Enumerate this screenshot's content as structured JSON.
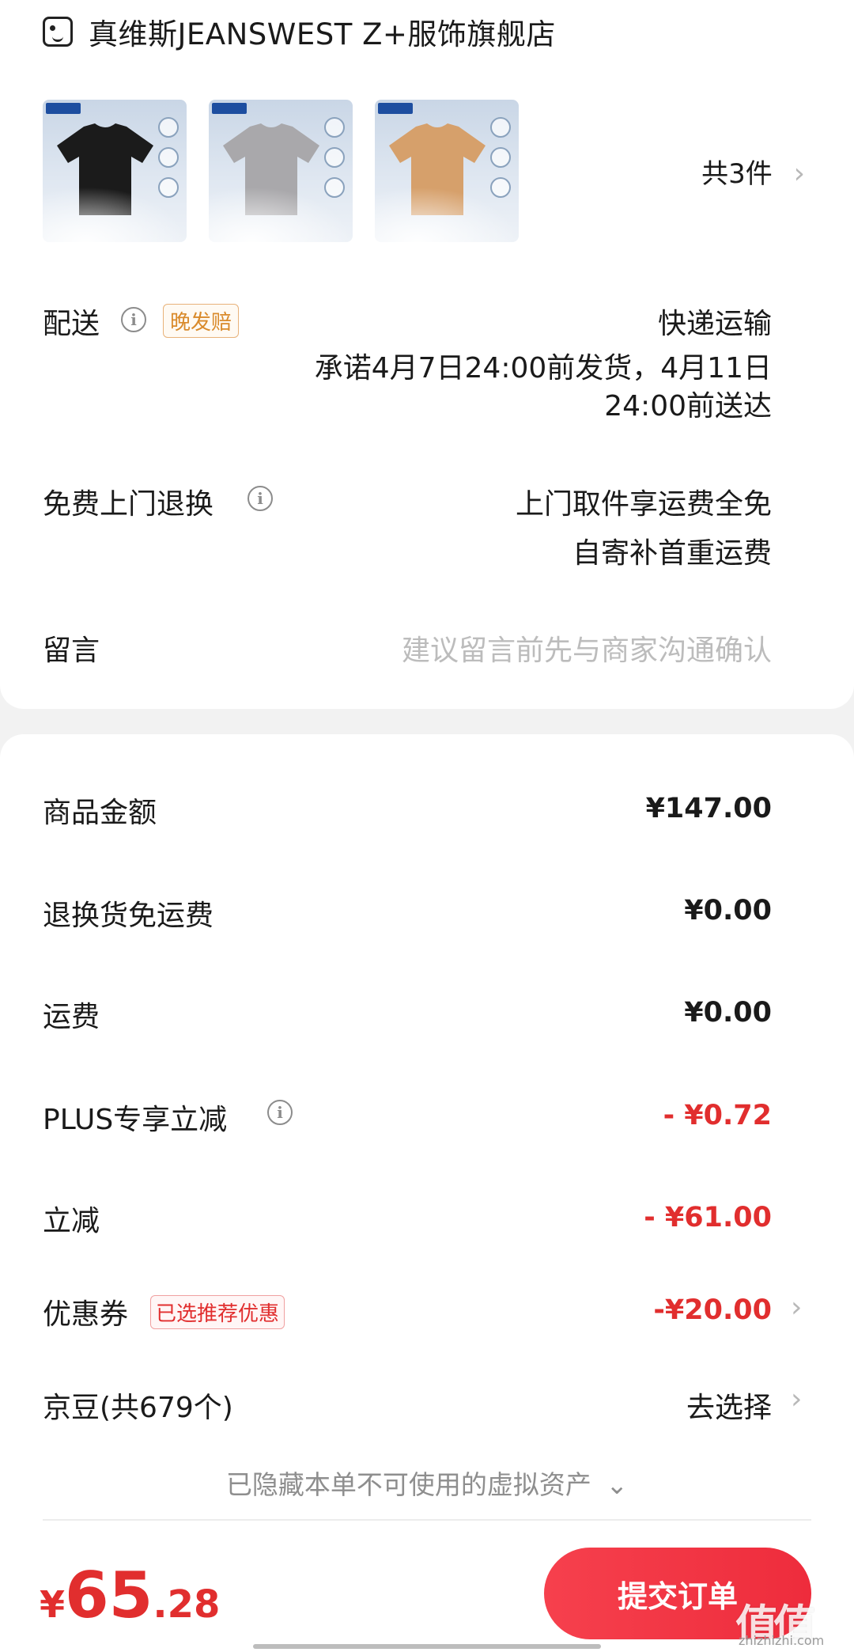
{
  "shop": {
    "name": "真维斯JEANSWEST Z+服饰旗舰店",
    "icon": "store-icon"
  },
  "products": {
    "thumbnails": [
      {
        "color": "#1b1b1b",
        "name": "black-tshirt"
      },
      {
        "color": "#a9a8ab",
        "name": "gray-tshirt"
      },
      {
        "color": "#d6a06b",
        "name": "khaki-tshirt"
      }
    ],
    "count_label": "共3件",
    "chevron": "›"
  },
  "delivery": {
    "label": "配送",
    "badge": "晚发赔",
    "method": "快递运输",
    "promise_line1": "承诺4月7日24:00前发货，4月11日",
    "promise_line2": "24:00前送达"
  },
  "return": {
    "label": "免费上门退换",
    "line1": "上门取件享运费全免",
    "line2": "自寄补首重运费"
  },
  "message": {
    "label": "留言",
    "placeholder": "建议留言前先与商家沟通确认"
  },
  "costs": {
    "goods_label": "商品金额",
    "goods_value": "¥147.00",
    "return_free_label": "退换货免运费",
    "return_free_value": "¥0.00",
    "shipping_label": "运费",
    "shipping_value": "¥0.00",
    "plus_label": "PLUS专享立减",
    "plus_value": "- ¥0.72",
    "discount_label": "立减",
    "discount_value": "- ¥61.00",
    "coupon_label": "优惠券",
    "coupon_badge": "已选推荐优惠",
    "coupon_value": "-¥20.00",
    "beans_label": "京豆(共679个)",
    "beans_action": "去选择",
    "hidden_note": "已隐藏本单不可使用的虚拟资产",
    "hidden_chevron": "⌄"
  },
  "footer": {
    "currency": "¥",
    "total_int": "65",
    "total_dec": ".28",
    "submit_label": "提交订单",
    "watermark_glyph": "值值值",
    "watermark_url": "zhizhizhi.com"
  },
  "colors": {
    "accent_red": "#e12e2e",
    "badge_orange": "#d98a2b"
  }
}
